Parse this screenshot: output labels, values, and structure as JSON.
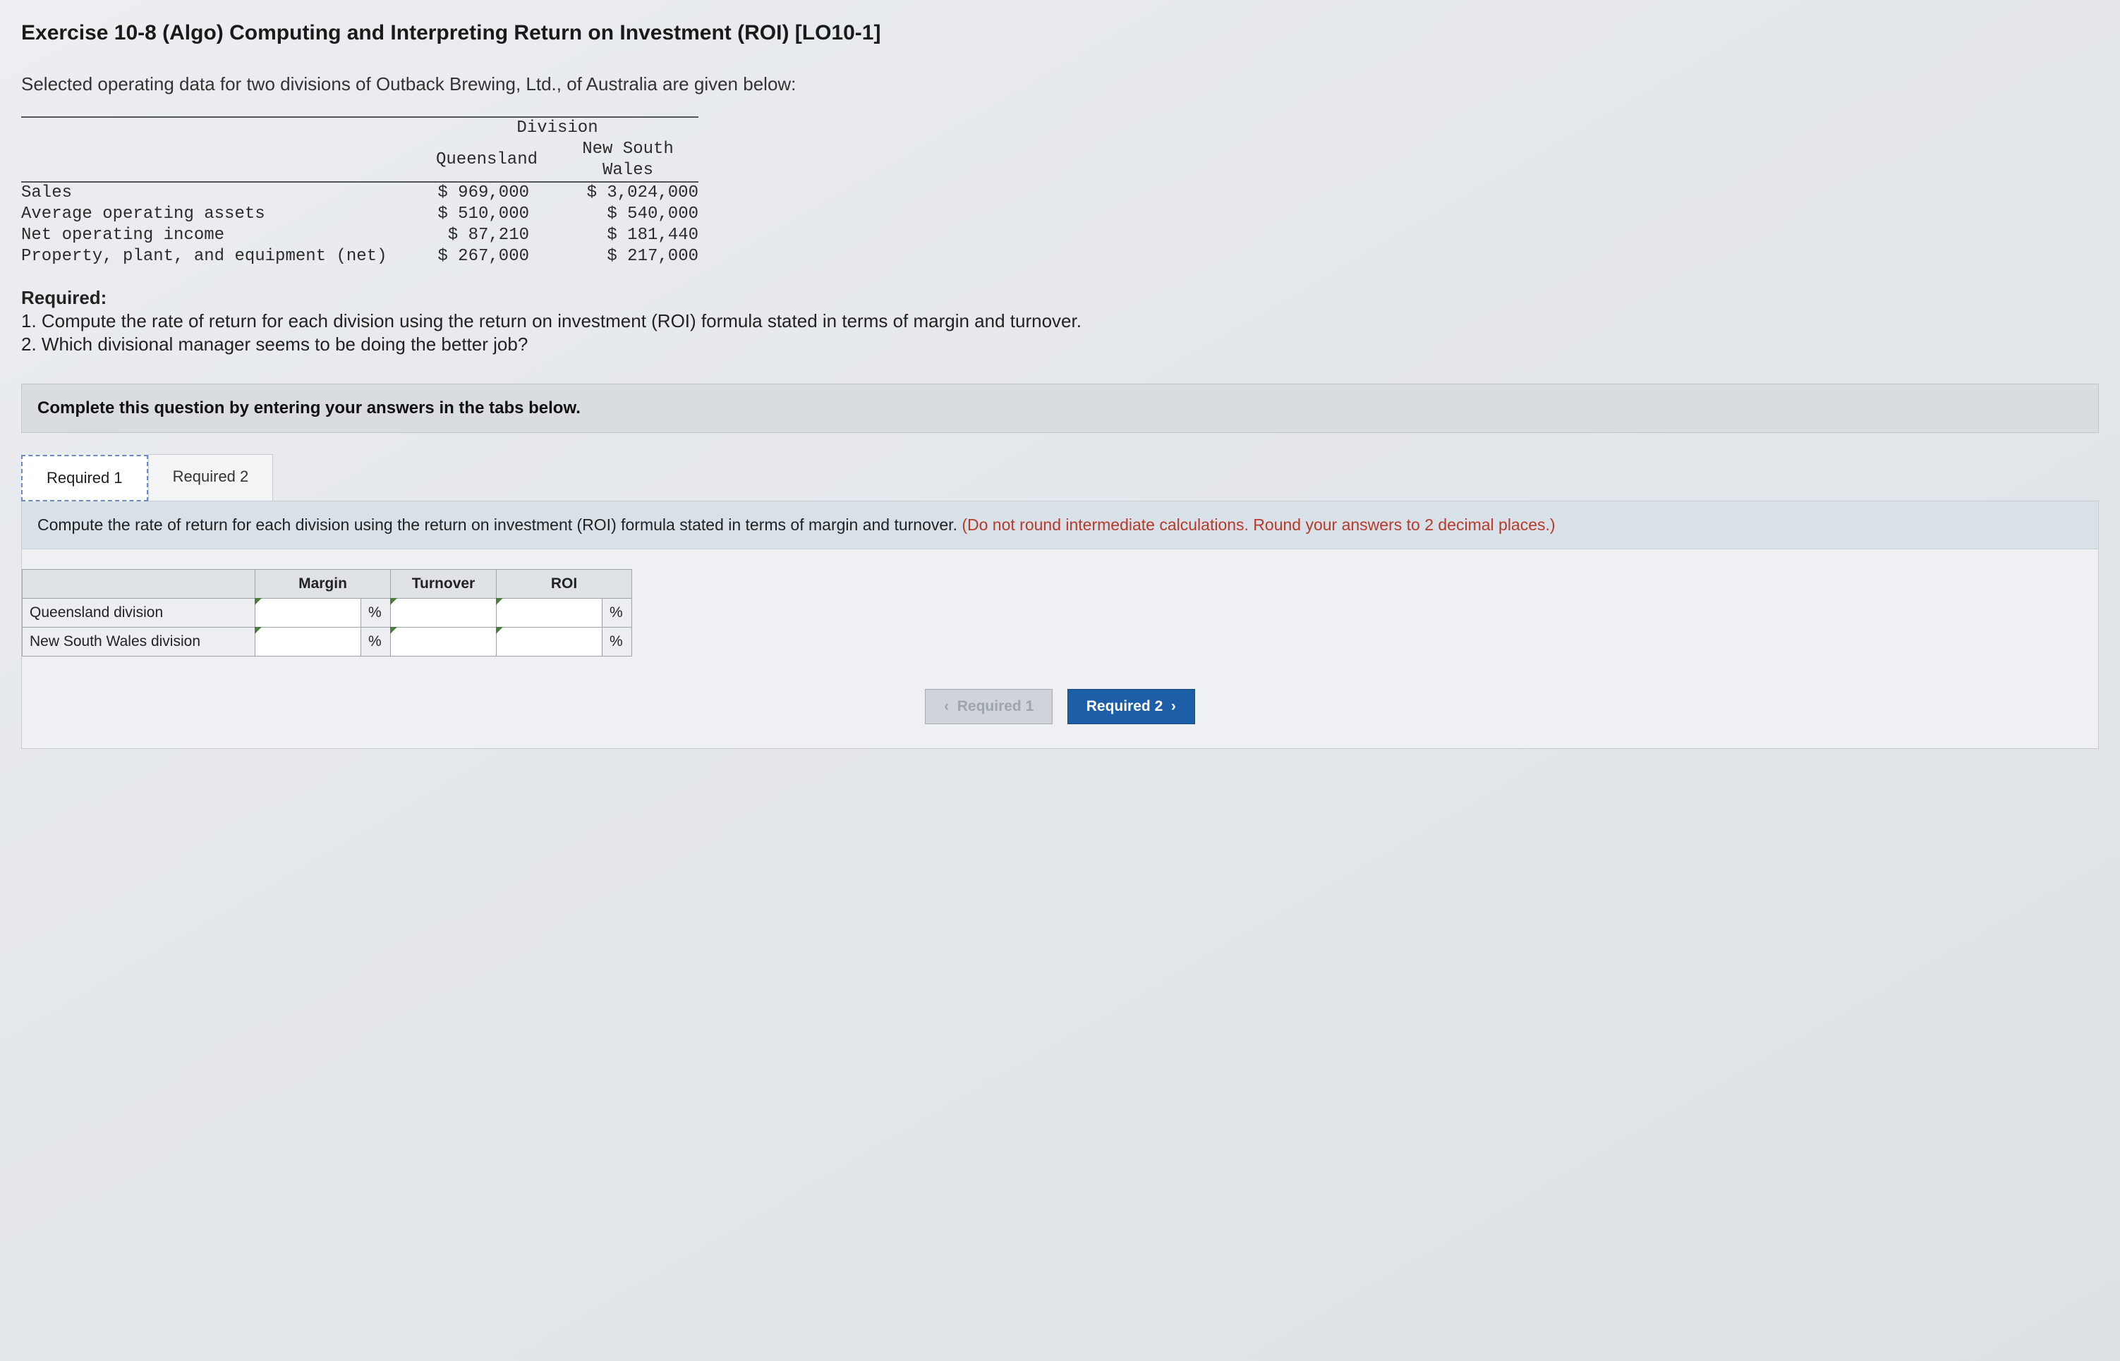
{
  "title": "Exercise 10-8 (Algo) Computing and Interpreting Return on Investment (ROI) [LO10-1]",
  "intro": "Selected operating data for two divisions of Outback Brewing, Ltd., of Australia are given below:",
  "data_table": {
    "span_header": "Division",
    "col_headers": [
      "Queensland",
      "New South\nWales"
    ],
    "rows": [
      {
        "label": "Sales",
        "q": "$ 969,000",
        "n": "$ 3,024,000"
      },
      {
        "label": "Average operating assets",
        "q": "$ 510,000",
        "n": "$ 540,000"
      },
      {
        "label": "Net operating income",
        "q": "$ 87,210",
        "n": "$ 181,440"
      },
      {
        "label": "Property, plant, and equipment (net)",
        "q": "$ 267,000",
        "n": "$ 217,000"
      }
    ]
  },
  "required": {
    "heading": "Required:",
    "items": [
      "1. Compute the rate of return for each division using the return on investment (ROI) formula stated in terms of margin and turnover.",
      "2. Which divisional manager seems to be doing the better job?"
    ]
  },
  "instruction_box": "Complete this question by entering your answers in the tabs below.",
  "tabs": {
    "tab1": "Required 1",
    "tab2": "Required 2"
  },
  "sub_instruction": {
    "main": "Compute the rate of return for each division using the return on investment (ROI) formula stated in terms of margin and turnover. ",
    "hint": "(Do not round intermediate calculations. Round your answers to 2 decimal places.)"
  },
  "answer_table": {
    "headers": [
      "",
      "Margin",
      "Turnover",
      "ROI"
    ],
    "rows": [
      {
        "label": "Queensland division",
        "margin": "",
        "margin_unit": "%",
        "turnover": "",
        "roi": "",
        "roi_unit": "%"
      },
      {
        "label": "New South Wales division",
        "margin": "",
        "margin_unit": "%",
        "turnover": "",
        "roi": "",
        "roi_unit": "%"
      }
    ]
  },
  "nav": {
    "prev": "Required 1",
    "next": "Required 2"
  },
  "chart_data": {
    "type": "table",
    "title": "Division Operating Data",
    "columns": [
      "Metric",
      "Queensland",
      "New South Wales"
    ],
    "rows": [
      [
        "Sales",
        969000,
        3024000
      ],
      [
        "Average operating assets",
        510000,
        540000
      ],
      [
        "Net operating income",
        87210,
        181440
      ],
      [
        "Property, plant, and equipment (net)",
        267000,
        217000
      ]
    ]
  }
}
